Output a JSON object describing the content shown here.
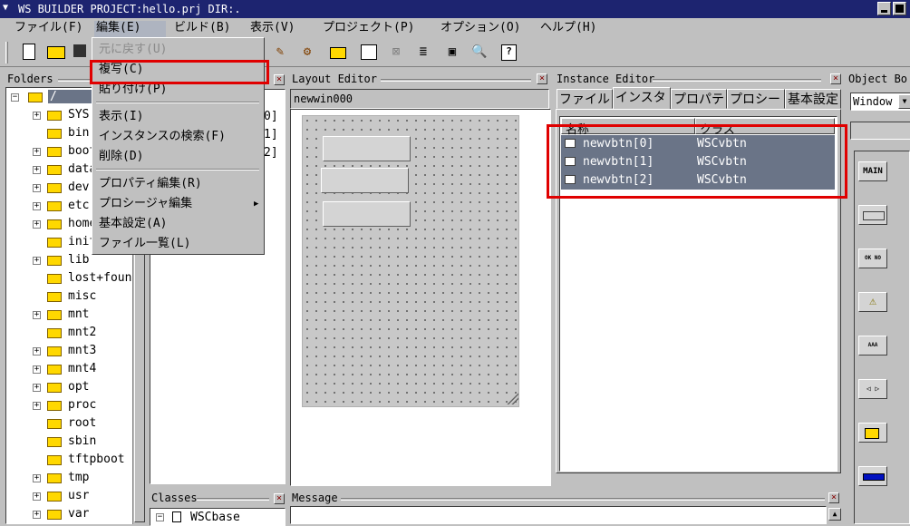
{
  "window": {
    "title": "WS BUILDER PROJECT:hello.prj DIR:."
  },
  "menubar": [
    {
      "label": "ファイル(F)"
    },
    {
      "label": "編集(E)"
    },
    {
      "label": "ビルド(B)"
    },
    {
      "label": "表示(V)"
    },
    {
      "label": "プロジェクト(P)"
    },
    {
      "label": "オプション(O)"
    },
    {
      "label": "ヘルプ(H)"
    }
  ],
  "edit_menu": {
    "items": [
      {
        "label": "元に戻す(U)",
        "disabled": true
      },
      {
        "label": "複写(C)",
        "highlighted": true
      },
      {
        "label": "貼り付け(P)"
      },
      {
        "label": "表示(I)"
      },
      {
        "label": "インスタンスの検索(F)"
      },
      {
        "label": "削除(D)"
      },
      {
        "label": "プロパティ編集(R)"
      },
      {
        "label": "プロシージャ編集",
        "submenu": true
      },
      {
        "label": "基本設定(A)"
      },
      {
        "label": "ファイル一覧(L)"
      }
    ]
  },
  "folders": {
    "title": "Folders",
    "root": "/",
    "items": [
      "SYS",
      "bin",
      "boot",
      "data",
      "dev",
      "etc",
      "home",
      "init",
      "lib",
      "lost+found",
      "misc",
      "mnt",
      "mnt2",
      "mnt3",
      "mnt4",
      "opt",
      "proc",
      "root",
      "sbin",
      "tftpboot",
      "tmp",
      "usr",
      "var"
    ],
    "expandable": [
      true,
      false,
      true,
      true,
      true,
      true,
      true,
      false,
      true,
      false,
      false,
      true,
      false,
      true,
      true,
      true,
      true,
      false,
      false,
      false,
      true,
      true,
      true
    ]
  },
  "objects_partial": [
    "0]",
    "1]",
    "2]"
  ],
  "layout_editor": {
    "title": "Layout Editor",
    "window_name": "newwin000"
  },
  "instance_editor": {
    "title": "Instance Editor",
    "tabs": [
      "ファイル",
      "インスタ",
      "プロパテ",
      "プロシー",
      "基本設定"
    ],
    "columns": [
      "名称",
      "クラス"
    ],
    "rows": [
      {
        "name": "newvbtn[0]",
        "class": "WSCvbtn"
      },
      {
        "name": "newvbtn[1]",
        "class": "WSCvbtn"
      },
      {
        "name": "newvbtn[2]",
        "class": "WSCvbtn"
      }
    ]
  },
  "object_box": {
    "title": "Object Bo",
    "combo_value": "Window"
  },
  "palette": [
    "MAIN",
    "",
    "OK NO",
    "⚠",
    "AAA",
    "◁ ▷",
    "",
    ""
  ],
  "classes": {
    "title": "Classes",
    "item": "WSCbase"
  },
  "message": {
    "title": "Message"
  }
}
